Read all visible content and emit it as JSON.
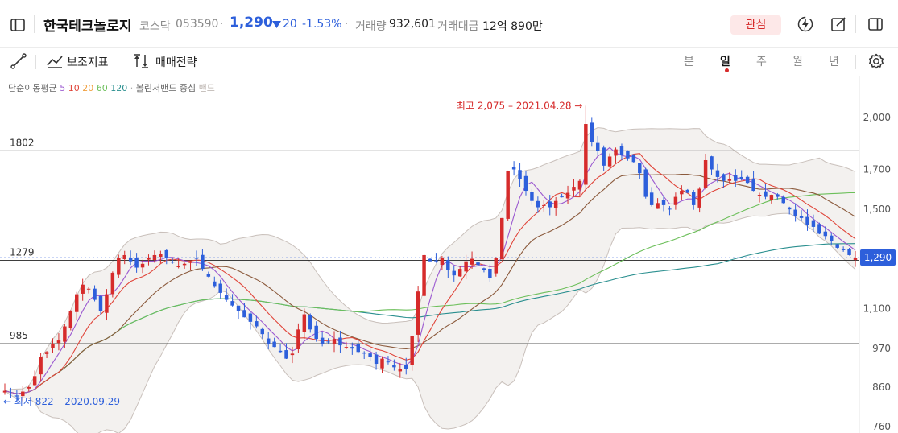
{
  "header": {
    "stock_name": "한국테크놀로지",
    "market": "코스닥",
    "code": "053590",
    "sep": "·",
    "price": "1,290",
    "change_icon": "triangle-down-icon",
    "change": "20",
    "change_pct": "-1.53%",
    "volume_label": "거래량",
    "volume": "932,601",
    "amount_label": "거래대금",
    "amount": "12억 890만",
    "watch_label": "관심",
    "colors": {
      "down": "#2d5fdb",
      "up": "#d62b2b",
      "watch_bg": "#fde8e8"
    }
  },
  "toolbar": {
    "draw_icon": "line-draw-icon",
    "indicator_label": "보조지표",
    "strategy_label": "매매전략",
    "periods": [
      {
        "label": "분",
        "active": false
      },
      {
        "label": "일",
        "active": true
      },
      {
        "label": "주",
        "active": false
      },
      {
        "label": "월",
        "active": false
      },
      {
        "label": "년",
        "active": false
      }
    ],
    "settings_icon": "gear-icon"
  },
  "legend": {
    "ma_label": "단순이동평균",
    "ma_periods": [
      {
        "label": "5",
        "color": "#9b59d0"
      },
      {
        "label": "10",
        "color": "#e0453a"
      },
      {
        "label": "20",
        "color": "#f0a040"
      },
      {
        "label": "60",
        "color": "#6cbf5a"
      },
      {
        "label": "120",
        "color": "#2a8f8f"
      }
    ],
    "bb_label": "볼린저밴드",
    "bb_center": "중심",
    "bb_band": "밴드"
  },
  "chart_data": {
    "type": "candlestick",
    "y_ticks": [
      "2,000",
      "1,700",
      "1,500",
      "1,100",
      "970",
      "860",
      "760"
    ],
    "y_scale": "log",
    "ylim": [
      760,
      2150
    ],
    "h_lines": [
      {
        "label": "1802",
        "value": 1802
      },
      {
        "label": "1279",
        "value": 1279
      },
      {
        "label": "985",
        "value": 985
      }
    ],
    "current_price": {
      "label": "1,290",
      "value": 1290
    },
    "high_annotation": {
      "text": "최고 2,075 – 2021.04.28 →",
      "value": 2075
    },
    "low_annotation": {
      "text": "← 최저 822 – 2020.09.29",
      "value": 822
    },
    "closes": [
      850,
      842,
      835,
      848,
      860,
      890,
      945,
      960,
      985,
      995,
      1040,
      1090,
      1150,
      1185,
      1170,
      1130,
      1090,
      1150,
      1230,
      1290,
      1300,
      1275,
      1250,
      1265,
      1290,
      1300,
      1305,
      1290,
      1270,
      1255,
      1265,
      1275,
      1285,
      1245,
      1215,
      1180,
      1155,
      1130,
      1110,
      1090,
      1070,
      1055,
      1040,
      1015,
      985,
      975,
      960,
      940,
      955,
      1030,
      1080,
      1030,
      1000,
      985,
      990,
      1000,
      980,
      975,
      970,
      960,
      955,
      945,
      925,
      940,
      930,
      915,
      910,
      910,
      1010,
      1160,
      1300,
      1275,
      1275,
      1290,
      1240,
      1220,
      1245,
      1275,
      1285,
      1260,
      1240,
      1210,
      1290,
      1460,
      1690,
      1700,
      1650,
      1590,
      1540,
      1510,
      1520,
      1510,
      1540,
      1560,
      1580,
      1610,
      1640,
      1960,
      1850,
      1800,
      1720,
      1770,
      1810,
      1780,
      1760,
      1740,
      1680,
      1560,
      1520,
      1530,
      1520,
      1500,
      1560,
      1590,
      1580,
      1520,
      1600,
      1750,
      1700,
      1660,
      1640,
      1650,
      1640,
      1650,
      1630,
      1590,
      1570,
      1560,
      1570,
      1560,
      1530,
      1500,
      1470,
      1460,
      1430,
      1420,
      1390,
      1380,
      1360,
      1330,
      1320,
      1300,
      1290
    ],
    "ma_values": "computed from closes",
    "colors": {
      "up": "#d62b2b",
      "down": "#2d5fdb",
      "ma5": "#9b59d0",
      "ma10": "#e0453a",
      "ma20": "#8b5a3c",
      "ma60": "#6cbf5a",
      "ma120": "#2a8f8f",
      "bb_fill": "#f3f1ef",
      "bb_line": "#c9c0bb"
    }
  }
}
